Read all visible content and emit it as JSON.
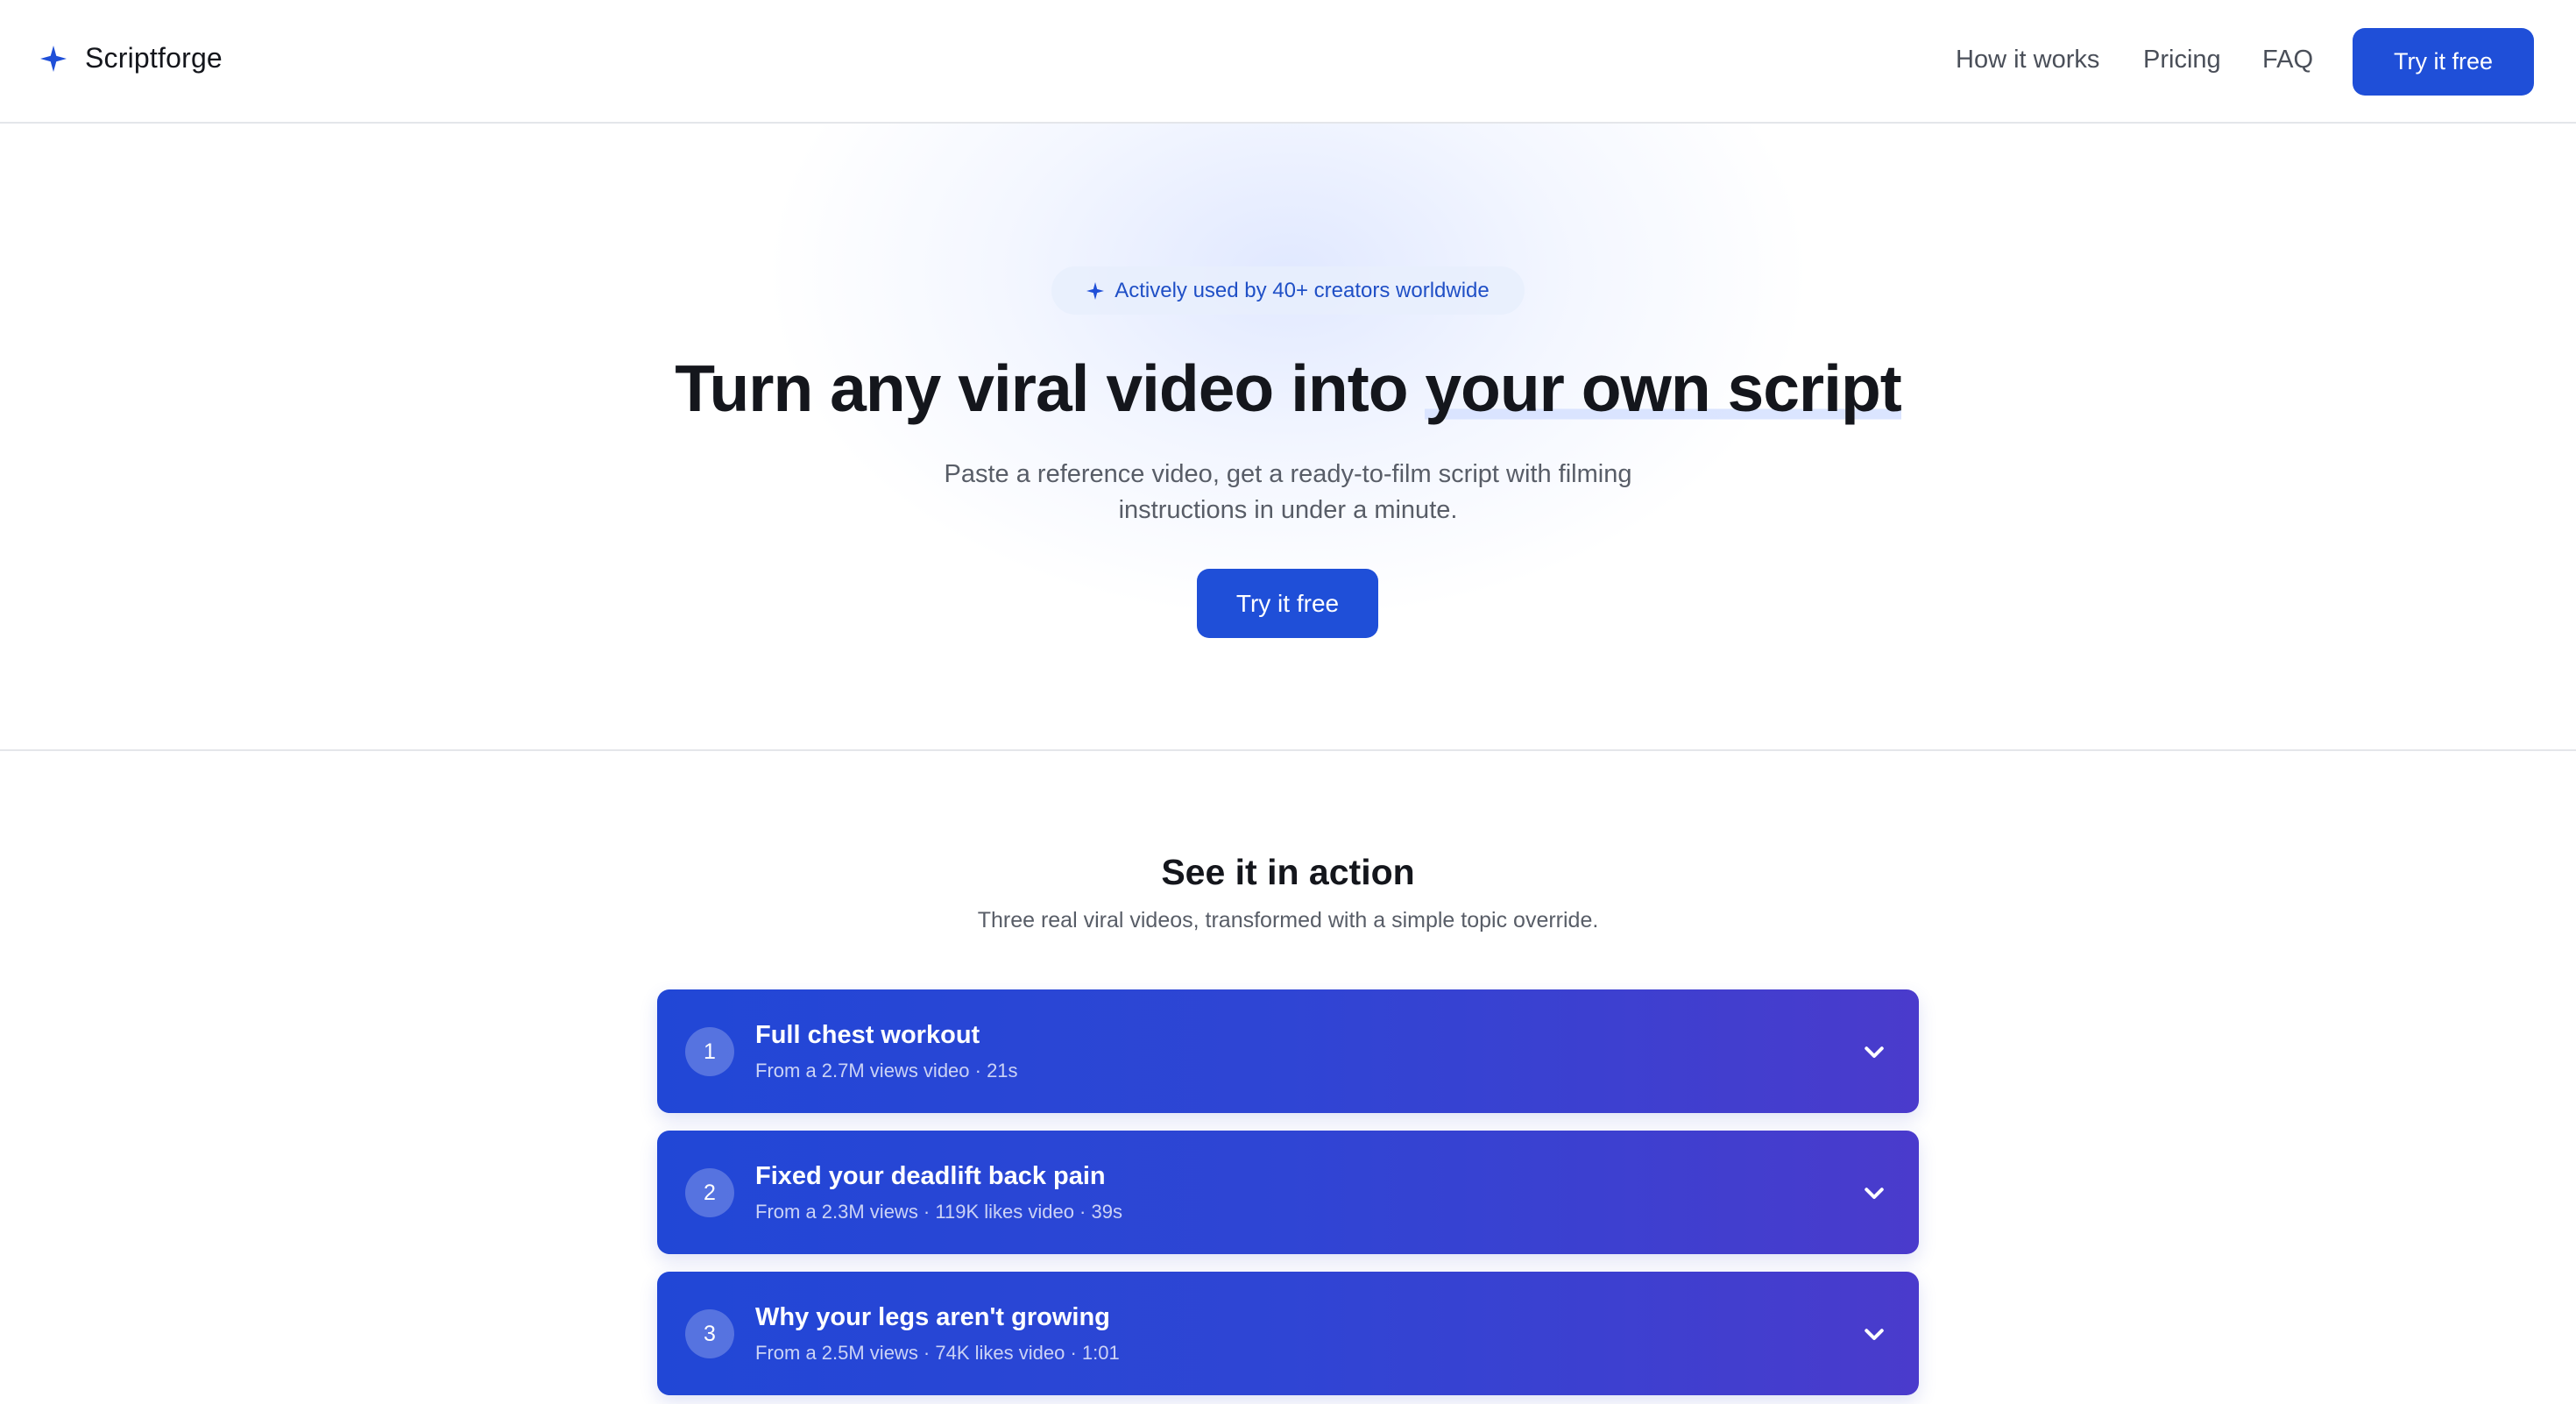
{
  "header": {
    "brand": "Scriptforge",
    "brand_icon": "sparkle-icon",
    "nav": [
      {
        "label": "How it works"
      },
      {
        "label": "Pricing"
      },
      {
        "label": "FAQ"
      }
    ],
    "cta_label": "Try it free"
  },
  "hero": {
    "badge_text": "Actively used by 40+ creators worldwide",
    "badge_icon": "sparkle-icon",
    "title_prefix": "Turn any viral video into ",
    "title_highlight": "your own script",
    "subtitle": "Paste a reference video, get a ready-to-film script with filming instructions in under a minute.",
    "cta_label": "Try it free"
  },
  "demo": {
    "title": "See it in action",
    "subtitle": "Three real viral videos, transformed with a simple topic override.",
    "items": [
      {
        "number": "1",
        "title": "Full chest workout",
        "meta": "From a 2.7M views video · 21s"
      },
      {
        "number": "2",
        "title": "Fixed your deadlift back pain",
        "meta": "From a 2.3M views · 119K likes video · 39s"
      },
      {
        "number": "3",
        "title": "Why your legs aren't growing",
        "meta": "From a 2.5M views · 74K likes video · 1:01"
      }
    ]
  },
  "colors": {
    "accent": "#1f4fd8",
    "card_gradient_start": "#2147d6",
    "card_gradient_end": "#4a3bcc",
    "text_primary": "#14161c",
    "text_secondary": "#585d67"
  }
}
